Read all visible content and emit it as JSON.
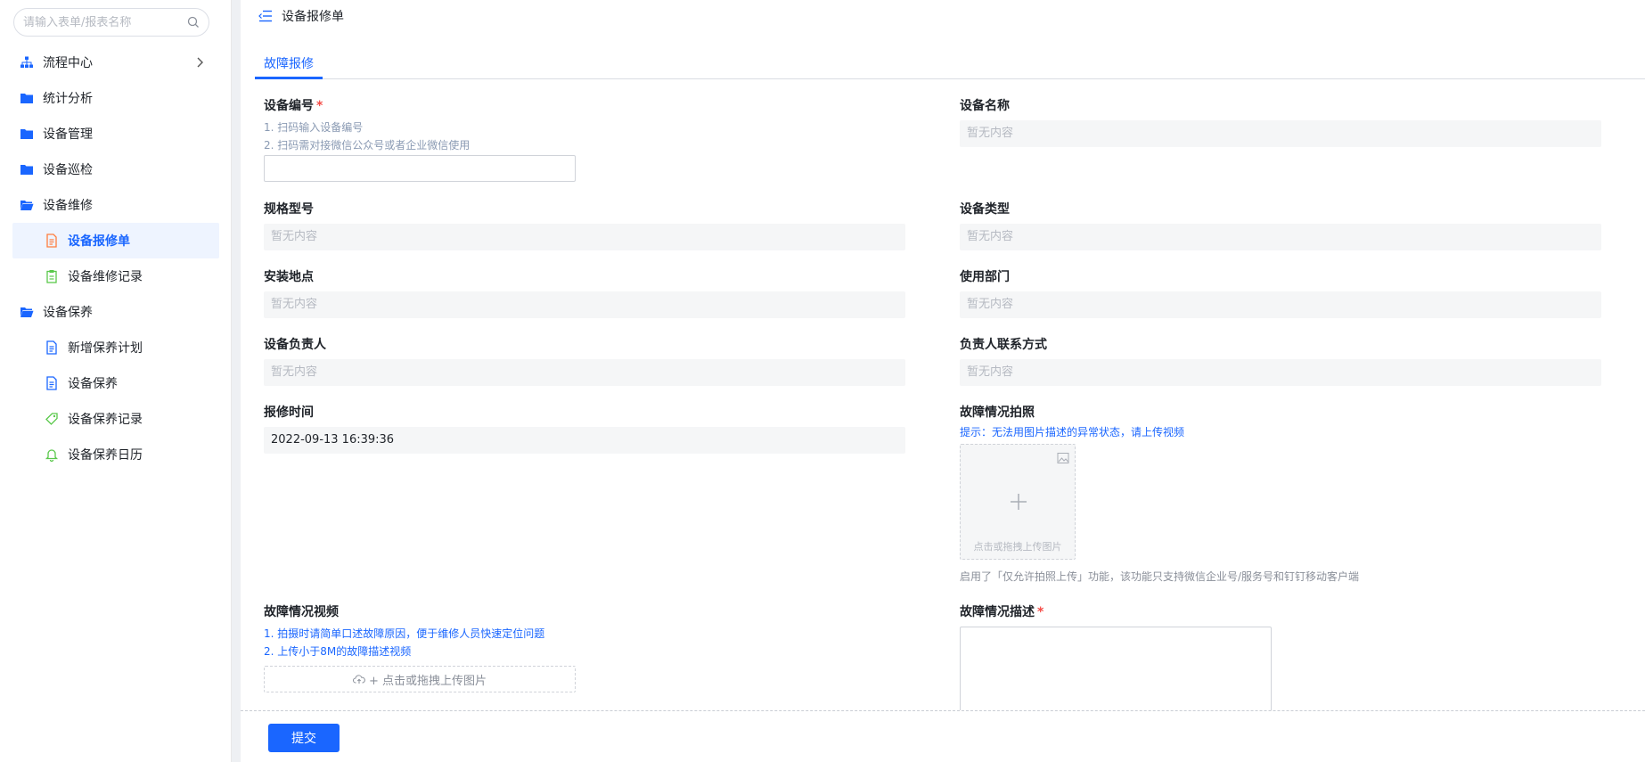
{
  "sidebar": {
    "search_placeholder": "请输入表单/报表名称",
    "items": [
      {
        "label": "流程中心"
      },
      {
        "label": "统计分析"
      },
      {
        "label": "设备管理"
      },
      {
        "label": "设备巡检"
      },
      {
        "label": "设备维修"
      },
      {
        "label": "设备报修单"
      },
      {
        "label": "设备维修记录"
      },
      {
        "label": "设备保养"
      },
      {
        "label": "新增保养计划"
      },
      {
        "label": "设备保养"
      },
      {
        "label": "设备保养记录"
      },
      {
        "label": "设备保养日历"
      }
    ]
  },
  "header": {
    "title": "设备报修单"
  },
  "tabs": [
    {
      "label": "故障报修"
    }
  ],
  "form": {
    "device_no": {
      "label": "设备编号",
      "required_mark": "*",
      "hint1": "1. 扫码输入设备编号",
      "hint2": "2. 扫码需对接微信公众号或者企业微信使用",
      "value": ""
    },
    "device_name": {
      "label": "设备名称",
      "value": "暂无内容"
    },
    "model": {
      "label": "规格型号",
      "value": "暂无内容"
    },
    "device_type": {
      "label": "设备类型",
      "value": "暂无内容"
    },
    "location": {
      "label": "安装地点",
      "value": "暂无内容"
    },
    "department": {
      "label": "使用部门",
      "value": "暂无内容"
    },
    "owner": {
      "label": "设备负责人",
      "value": "暂无内容"
    },
    "owner_contact": {
      "label": "负责人联系方式",
      "value": "暂无内容"
    },
    "report_time": {
      "label": "报修时间",
      "value": "2022-09-13 16:39:36"
    },
    "fault_photo": {
      "label": "故障情况拍照",
      "hint": "提示：无法用图片描述的异常状态，请上传视频",
      "upload_text": "点击或拖拽上传图片",
      "note": "启用了「仅允许拍照上传」功能，该功能只支持微信企业号/服务号和钉钉移动客户端"
    },
    "fault_video": {
      "label": "故障情况视频",
      "hint1": "1. 拍摄时请简单口述故障原因，便于维修人员快速定位问题",
      "hint2": "2. 上传小于8M的故障描述视频",
      "upload_text": "+ 点击或拖拽上传图片"
    },
    "fault_desc": {
      "label": "故障情况描述",
      "required_mark": "*",
      "value": ""
    }
  },
  "footer": {
    "submit_label": "提交"
  },
  "colors": {
    "accent": "#1a66ff",
    "required": "#f54a45",
    "folder": "#1a66ff",
    "doc_orange": "#ff7d3d",
    "doc_green": "#5ac84b"
  }
}
